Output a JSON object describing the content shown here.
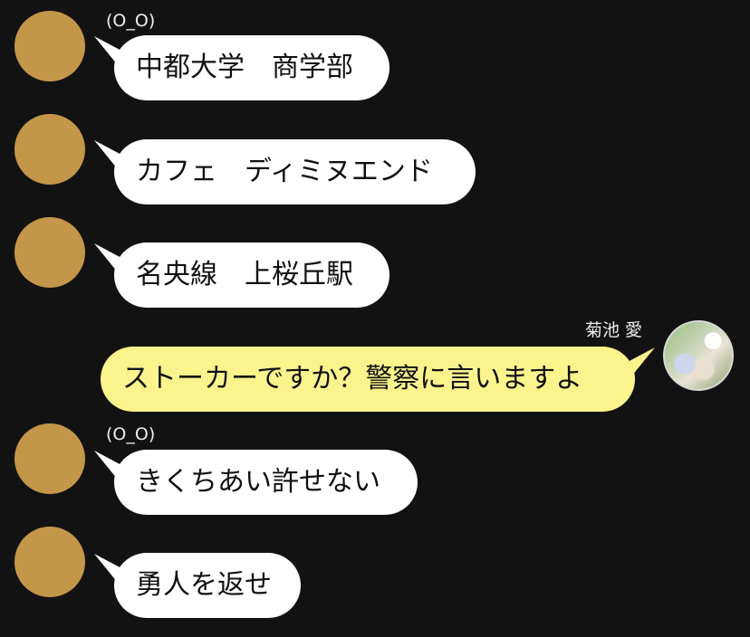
{
  "messages": [
    {
      "side": "left",
      "sender": "(O_O)",
      "text": "中都大学　商学部"
    },
    {
      "side": "left",
      "sender": "",
      "text": "カフェ　ディミヌエンド"
    },
    {
      "side": "left",
      "sender": "",
      "text": "名央線　上桜丘駅"
    },
    {
      "side": "right",
      "sender": "菊池 愛",
      "text": "ストーカーですか？警察に言いますよ"
    },
    {
      "side": "left",
      "sender": "(O_O)",
      "text": "きくちあい許せない"
    },
    {
      "side": "left",
      "sender": "",
      "text": "勇人を返せ"
    }
  ],
  "colors": {
    "background": "#121212",
    "left_avatar": "#c4964a",
    "left_bubble": "#ffffff",
    "right_bubble": "#fbf48d",
    "sender_text": "#ededed"
  }
}
